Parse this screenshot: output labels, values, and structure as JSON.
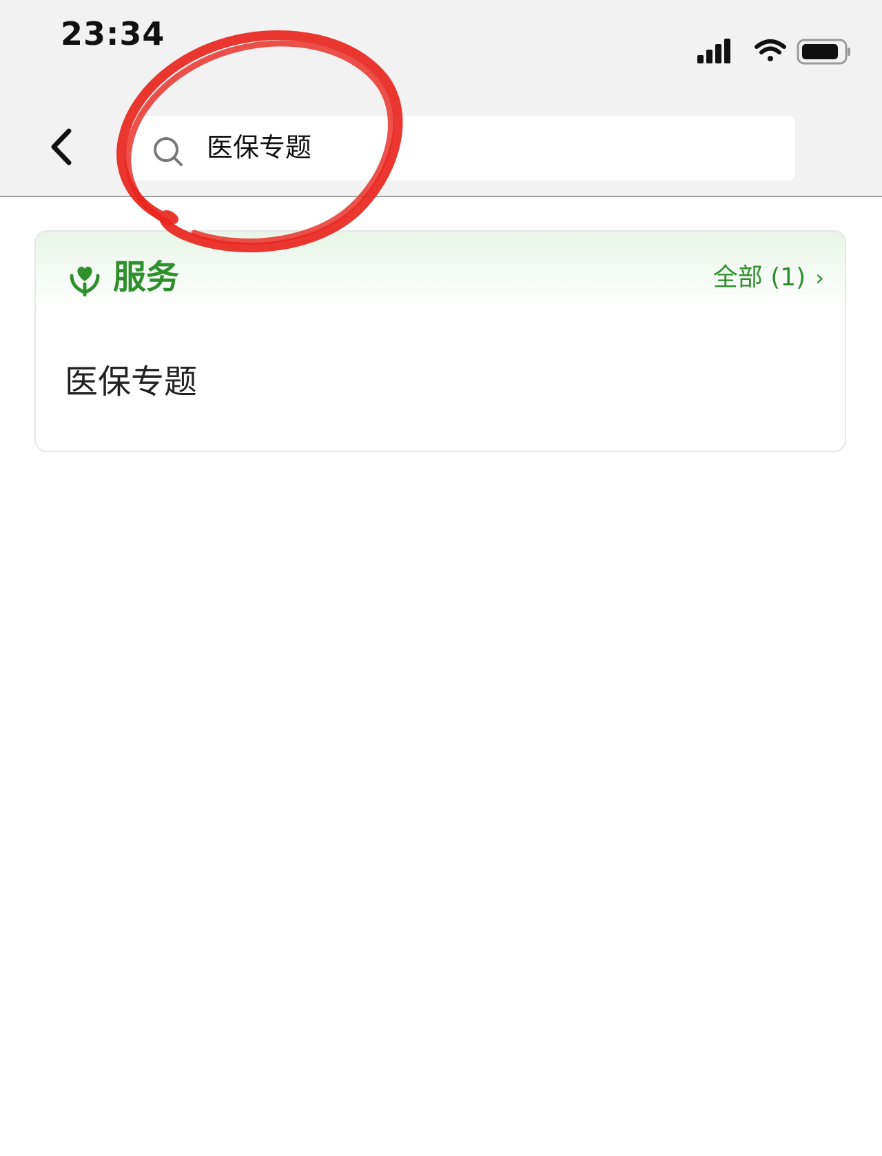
{
  "status_bar": {
    "time": "23:34",
    "icons": [
      "signal-icon",
      "wifi-icon",
      "battery-icon"
    ]
  },
  "nav": {
    "back_icon": "chevron-left-icon",
    "search": {
      "icon": "search-icon",
      "value": "医保专题"
    }
  },
  "results": {
    "section": {
      "icon": "heart-hands-icon",
      "title": "服务",
      "all_label": "全部 (1)",
      "all_chevron": "›"
    },
    "items": [
      {
        "label": "医保专题"
      }
    ]
  },
  "colors": {
    "accent_green": "#2f8f2c",
    "annotation_red": "#e8261e",
    "header_bg": "#f2f2f2"
  }
}
